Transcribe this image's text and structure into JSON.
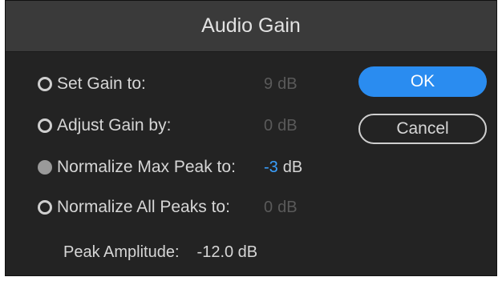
{
  "dialog": {
    "title": "Audio Gain"
  },
  "options": [
    {
      "label": "Set Gain to:",
      "value": "9",
      "unit": "dB",
      "selected": false,
      "enabled": false
    },
    {
      "label": "Adjust Gain by:",
      "value": "0",
      "unit": "dB",
      "selected": false,
      "enabled": false
    },
    {
      "label": "Normalize Max Peak to:",
      "value": "-3",
      "unit": "dB",
      "selected": true,
      "enabled": true
    },
    {
      "label": "Normalize All Peaks to:",
      "value": "0",
      "unit": "dB",
      "selected": false,
      "enabled": false
    }
  ],
  "buttons": {
    "ok": "OK",
    "cancel": "Cancel"
  },
  "peak": {
    "label": "Peak Amplitude:",
    "value": "-12.0 dB"
  },
  "colors": {
    "accent": "#2a8cf0",
    "active_value": "#3aa0ff"
  }
}
